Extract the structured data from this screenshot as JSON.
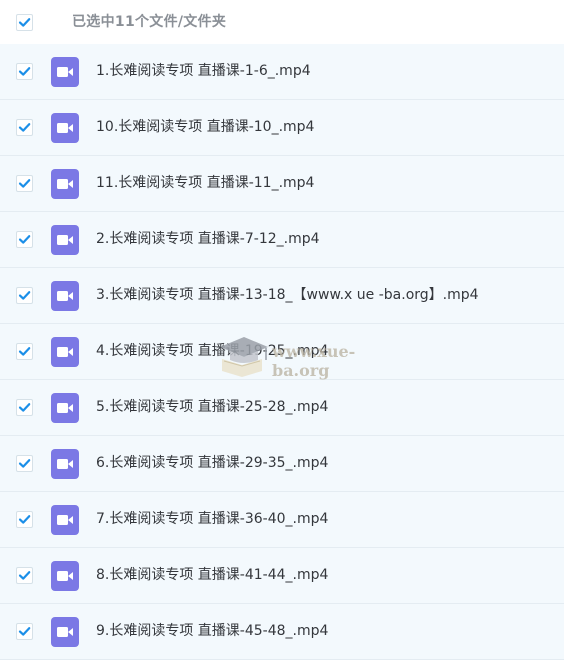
{
  "header": {
    "selection_text": "已选中11个文件/文件夹",
    "all_checked": true
  },
  "files": [
    {
      "name": "1.长难阅读专项 直播课-1-6_.mp4",
      "checked": true,
      "icon": "video-file-icon"
    },
    {
      "name": "10.长难阅读专项 直播课-10_.mp4",
      "checked": true,
      "icon": "video-file-icon"
    },
    {
      "name": "11.长难阅读专项 直播课-11_.mp4",
      "checked": true,
      "icon": "video-file-icon"
    },
    {
      "name": "2.长难阅读专项 直播课-7-12_.mp4",
      "checked": true,
      "icon": "video-file-icon"
    },
    {
      "name": "3.长难阅读专项 直播课-13-18_【www.x ue -ba.org】.mp4",
      "checked": true,
      "icon": "video-file-icon"
    },
    {
      "name": "4.长难阅读专项 直播课-19-25_.mp4",
      "checked": true,
      "icon": "video-file-icon"
    },
    {
      "name": "5.长难阅读专项 直播课-25-28_.mp4",
      "checked": true,
      "icon": "video-file-icon"
    },
    {
      "name": "6.长难阅读专项 直播课-29-35_.mp4",
      "checked": true,
      "icon": "video-file-icon"
    },
    {
      "name": "7.长难阅读专项 直播课-36-40_.mp4",
      "checked": true,
      "icon": "video-file-icon"
    },
    {
      "name": "8.长难阅读专项 直播课-41-44_.mp4",
      "checked": true,
      "icon": "video-file-icon"
    },
    {
      "name": "9.长难阅读专项 直播课-45-48_.mp4",
      "checked": true,
      "icon": "video-file-icon"
    }
  ],
  "watermark": {
    "text": "www.xue-ba.org"
  },
  "colors": {
    "check_blue": "#1c8fe8",
    "video_icon": "#7b78e5",
    "row_bg": "#f3f9fd",
    "row_border": "#e4ecf2",
    "filename_text": "#34373c",
    "header_text": "#8a8f96"
  }
}
